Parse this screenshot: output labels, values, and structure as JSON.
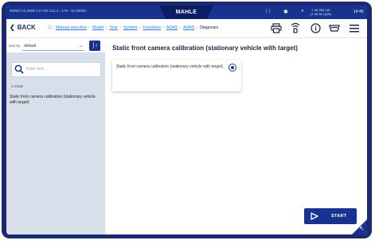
{
  "statusbar": {
    "vehicle_info": "DEMO A4 2008 2.0 TDI CCLA - 170 - ID 00000",
    "logo": "MAHLE",
    "coords": [
      "1.36.282.115",
      "(1.36.96.1)(IN)"
    ],
    "clock": "14:40",
    "icons": [
      "network-icon",
      "bluetooth-icon",
      "connection-dot-icon"
    ]
  },
  "nav": {
    "back_label": "BACK",
    "breadcrumbs": [
      "Manual selection",
      "Model",
      "Year",
      "System",
      "Functions",
      "ADAS",
      "ADAS",
      "Diagnosis"
    ],
    "icons": [
      "printer-icon",
      "wifi-tool-icon",
      "info-icon",
      "vci-icon",
      "menu-icon"
    ]
  },
  "sidebar": {
    "sort_label": "Sort by",
    "sort_value": "default",
    "search_placeholder": "Enter text...",
    "result_count": "1 result",
    "result_item": "Static front camera calibration (stationary vehicle with target)"
  },
  "main": {
    "title": "Static front camera calibration (stationary vehicle with target)",
    "card_text": "Static front camera calibration (stationary vehicle with target)",
    "card_selected": true
  },
  "actions": {
    "start_label": "START"
  },
  "colors": {
    "brand": "#17338f",
    "link": "#2d7be5",
    "panel": "#d7e0ea"
  }
}
